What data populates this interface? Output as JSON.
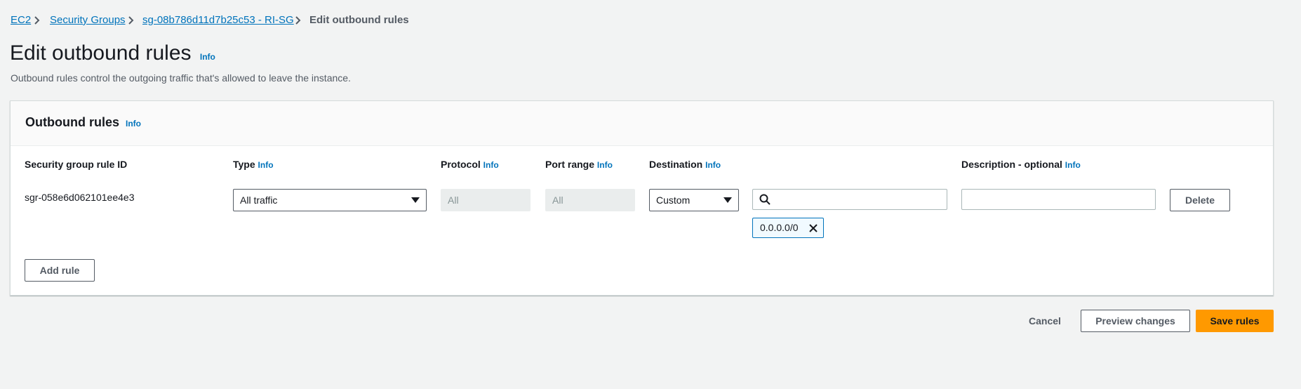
{
  "breadcrumb": {
    "items": [
      "EC2",
      "Security Groups",
      "sg-08b786d11d7b25c53 - RI-SG"
    ],
    "current": "Edit outbound rules"
  },
  "page": {
    "title": "Edit outbound rules",
    "info": "Info",
    "description": "Outbound rules control the outgoing traffic that's allowed to leave the instance."
  },
  "panel": {
    "title": "Outbound rules",
    "info": "Info",
    "columns": {
      "rule_id": "Security group rule ID",
      "type": "Type",
      "protocol": "Protocol",
      "port_range": "Port range",
      "destination": "Destination",
      "description": "Description - optional"
    },
    "row": {
      "rule_id": "sgr-058e6d062101ee4e3",
      "type": "All traffic",
      "protocol": "All",
      "port_range": "All",
      "destination_type": "Custom",
      "destination_search": "",
      "destination_token": "0.0.0.0/0",
      "description": "",
      "delete_label": "Delete"
    },
    "add_rule_label": "Add rule"
  },
  "footer": {
    "cancel_label": "Cancel",
    "preview_label": "Preview changes",
    "save_label": "Save rules"
  },
  "colors": {
    "link": "#0073bb",
    "primary": "#ff9900",
    "background": "#f2f3f3"
  }
}
